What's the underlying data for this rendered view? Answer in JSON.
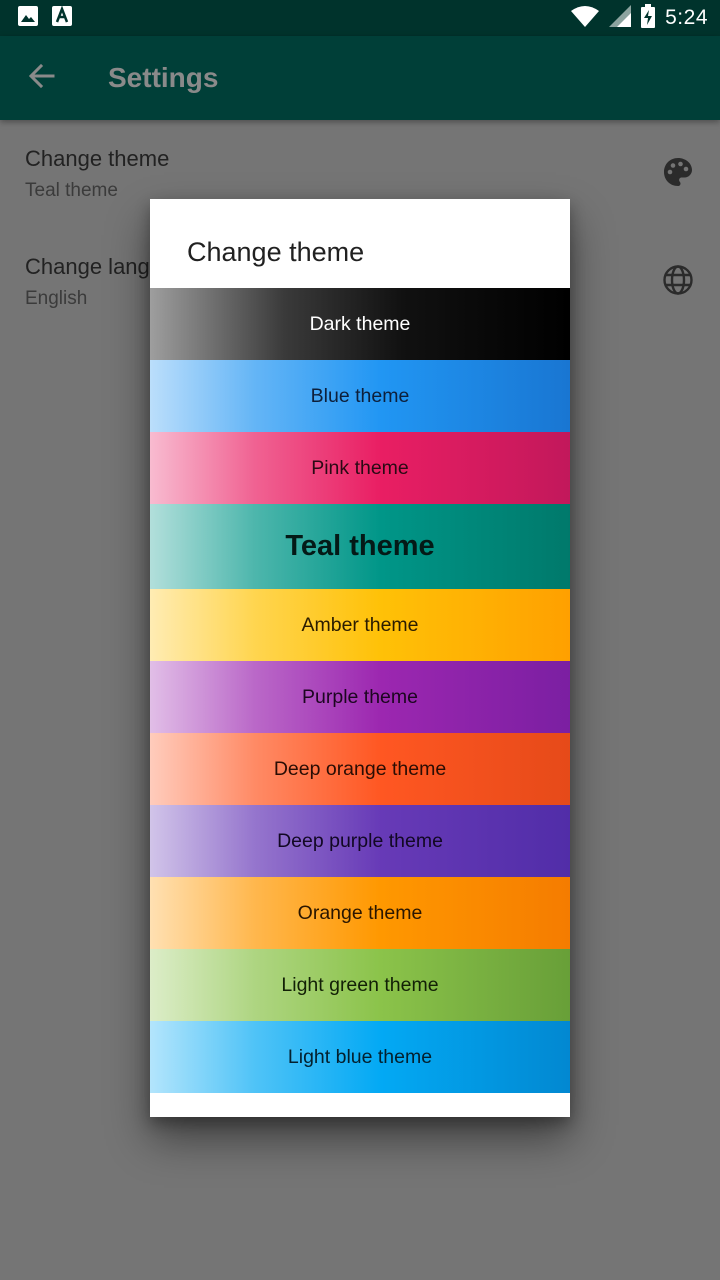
{
  "status_bar": {
    "time": "5:24",
    "icons": [
      "image-icon",
      "font-icon",
      "wifi-icon",
      "signal-icon",
      "battery-charging-icon"
    ]
  },
  "app_bar": {
    "title": "Settings",
    "back_icon": "arrow-back-icon"
  },
  "settings": {
    "items": [
      {
        "title": "Change theme",
        "subtitle": "Teal theme",
        "icon": "palette-icon"
      },
      {
        "title": "Change language",
        "subtitle": "English",
        "icon": "globe-icon"
      }
    ]
  },
  "dialog": {
    "title": "Change theme",
    "selected": "Teal theme",
    "themes": [
      {
        "label": "Dark theme"
      },
      {
        "label": "Blue theme"
      },
      {
        "label": "Pink theme"
      },
      {
        "label": "Teal theme"
      },
      {
        "label": "Amber theme"
      },
      {
        "label": "Purple theme"
      },
      {
        "label": "Deep orange theme"
      },
      {
        "label": "Deep purple theme"
      },
      {
        "label": "Orange theme"
      },
      {
        "label": "Light green theme"
      },
      {
        "label": "Light blue theme"
      }
    ]
  },
  "colors": {
    "status_bar": "#00332c",
    "app_bar": "#003f38",
    "scrim_background": "#757575",
    "dialog_background": "#ffffff"
  }
}
